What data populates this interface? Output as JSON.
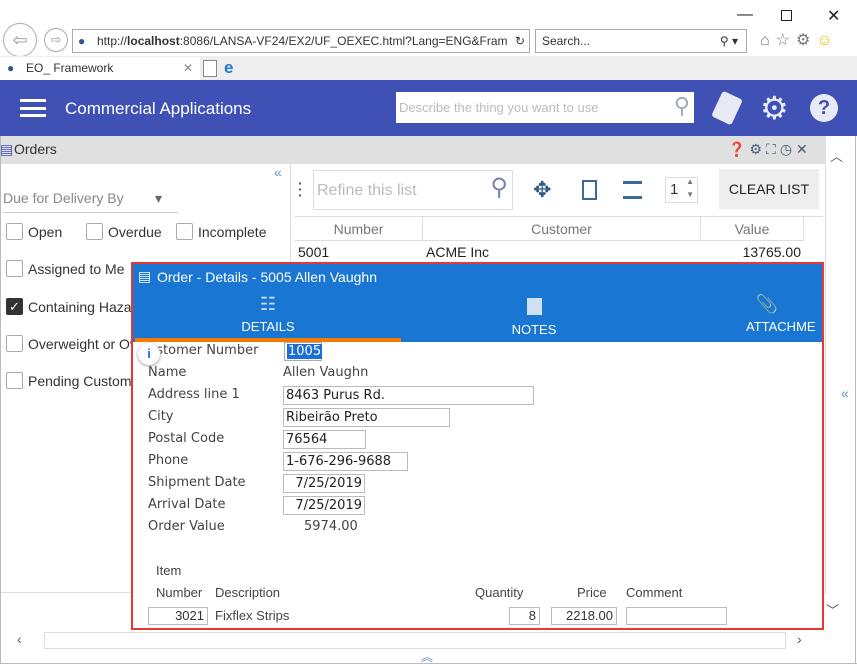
{
  "browser": {
    "url_prefix": "http://",
    "url_host": "localhost",
    "url_rest": ":8086/LANSA-VF24/EX2/UF_OEXEC.html?Lang=ENG&Fram",
    "search_placeholder": "Search...",
    "tab_title": "EO_ Framework"
  },
  "app": {
    "title": "Commercial Applications",
    "search_placeholder": "Describe the thing you want to use",
    "accent": "#3f51b5"
  },
  "orders": {
    "title": "Orders",
    "filter_select": "Due for Delivery By",
    "filters": [
      {
        "label": "Open",
        "checked": false
      },
      {
        "label": "Overdue",
        "checked": false
      },
      {
        "label": "Incomplete",
        "checked": false
      },
      {
        "label": "Assigned to Me",
        "checked": false
      },
      {
        "label": "Containing Haza",
        "checked": true
      },
      {
        "label": "Overweight or Ov",
        "checked": false
      },
      {
        "label": "Pending Custom",
        "checked": false
      }
    ],
    "refine_placeholder": "Refine this list",
    "page_value": "1",
    "clear_label": "CLEAR LIST",
    "columns": [
      "Number",
      "Customer",
      "Value"
    ],
    "rows": [
      {
        "number": "5001",
        "customer": "ACME Inc",
        "value": "13765.00"
      }
    ]
  },
  "details": {
    "title": "Order - Details - 5005 Allen Vaughn",
    "tabs": [
      "DETAILS",
      "NOTES",
      "ATTACHME"
    ],
    "header_color": "#1976d2",
    "active_color": "#f57c00",
    "fields": {
      "customer_number_label": "ustomer Number",
      "customer_number": "1005",
      "name_label": "Name",
      "name": "Allen Vaughn",
      "address_label": "Address line 1",
      "address": "8463 Purus Rd.",
      "city_label": "City",
      "city": "Ribeirão Preto",
      "postal_label": "Postal Code",
      "postal": "76564",
      "phone_label": "Phone",
      "phone": "1-676-296-9688",
      "shipment_label": "Shipment Date",
      "shipment": "7/25/2019",
      "arrival_label": "Arrival Date",
      "arrival": "7/25/2019",
      "value_label": "Order Value",
      "value": "5974.00"
    },
    "items_header": {
      "item": "Item",
      "number": "Number",
      "description": "Description",
      "quantity": "Quantity",
      "price": "Price",
      "comment": "Comment"
    },
    "items": [
      {
        "number": "3021",
        "description": "Fixflex Strips",
        "quantity": "8",
        "price": "2218.00",
        "comment": ""
      }
    ]
  }
}
